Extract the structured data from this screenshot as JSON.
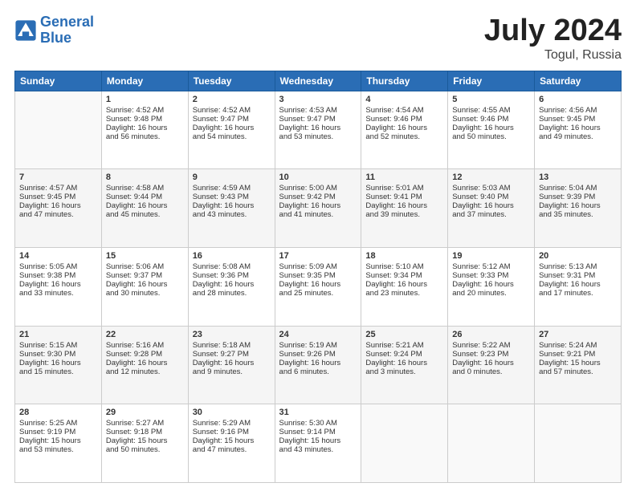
{
  "header": {
    "logo_line1": "General",
    "logo_line2": "Blue",
    "month": "July 2024",
    "location": "Togul, Russia"
  },
  "columns": [
    "Sunday",
    "Monday",
    "Tuesday",
    "Wednesday",
    "Thursday",
    "Friday",
    "Saturday"
  ],
  "weeks": [
    [
      {
        "day": "",
        "content": ""
      },
      {
        "day": "1",
        "content": "Sunrise: 4:52 AM\nSunset: 9:48 PM\nDaylight: 16 hours\nand 56 minutes."
      },
      {
        "day": "2",
        "content": "Sunrise: 4:52 AM\nSunset: 9:47 PM\nDaylight: 16 hours\nand 54 minutes."
      },
      {
        "day": "3",
        "content": "Sunrise: 4:53 AM\nSunset: 9:47 PM\nDaylight: 16 hours\nand 53 minutes."
      },
      {
        "day": "4",
        "content": "Sunrise: 4:54 AM\nSunset: 9:46 PM\nDaylight: 16 hours\nand 52 minutes."
      },
      {
        "day": "5",
        "content": "Sunrise: 4:55 AM\nSunset: 9:46 PM\nDaylight: 16 hours\nand 50 minutes."
      },
      {
        "day": "6",
        "content": "Sunrise: 4:56 AM\nSunset: 9:45 PM\nDaylight: 16 hours\nand 49 minutes."
      }
    ],
    [
      {
        "day": "7",
        "content": "Sunrise: 4:57 AM\nSunset: 9:45 PM\nDaylight: 16 hours\nand 47 minutes."
      },
      {
        "day": "8",
        "content": "Sunrise: 4:58 AM\nSunset: 9:44 PM\nDaylight: 16 hours\nand 45 minutes."
      },
      {
        "day": "9",
        "content": "Sunrise: 4:59 AM\nSunset: 9:43 PM\nDaylight: 16 hours\nand 43 minutes."
      },
      {
        "day": "10",
        "content": "Sunrise: 5:00 AM\nSunset: 9:42 PM\nDaylight: 16 hours\nand 41 minutes."
      },
      {
        "day": "11",
        "content": "Sunrise: 5:01 AM\nSunset: 9:41 PM\nDaylight: 16 hours\nand 39 minutes."
      },
      {
        "day": "12",
        "content": "Sunrise: 5:03 AM\nSunset: 9:40 PM\nDaylight: 16 hours\nand 37 minutes."
      },
      {
        "day": "13",
        "content": "Sunrise: 5:04 AM\nSunset: 9:39 PM\nDaylight: 16 hours\nand 35 minutes."
      }
    ],
    [
      {
        "day": "14",
        "content": "Sunrise: 5:05 AM\nSunset: 9:38 PM\nDaylight: 16 hours\nand 33 minutes."
      },
      {
        "day": "15",
        "content": "Sunrise: 5:06 AM\nSunset: 9:37 PM\nDaylight: 16 hours\nand 30 minutes."
      },
      {
        "day": "16",
        "content": "Sunrise: 5:08 AM\nSunset: 9:36 PM\nDaylight: 16 hours\nand 28 minutes."
      },
      {
        "day": "17",
        "content": "Sunrise: 5:09 AM\nSunset: 9:35 PM\nDaylight: 16 hours\nand 25 minutes."
      },
      {
        "day": "18",
        "content": "Sunrise: 5:10 AM\nSunset: 9:34 PM\nDaylight: 16 hours\nand 23 minutes."
      },
      {
        "day": "19",
        "content": "Sunrise: 5:12 AM\nSunset: 9:33 PM\nDaylight: 16 hours\nand 20 minutes."
      },
      {
        "day": "20",
        "content": "Sunrise: 5:13 AM\nSunset: 9:31 PM\nDaylight: 16 hours\nand 17 minutes."
      }
    ],
    [
      {
        "day": "21",
        "content": "Sunrise: 5:15 AM\nSunset: 9:30 PM\nDaylight: 16 hours\nand 15 minutes."
      },
      {
        "day": "22",
        "content": "Sunrise: 5:16 AM\nSunset: 9:28 PM\nDaylight: 16 hours\nand 12 minutes."
      },
      {
        "day": "23",
        "content": "Sunrise: 5:18 AM\nSunset: 9:27 PM\nDaylight: 16 hours\nand 9 minutes."
      },
      {
        "day": "24",
        "content": "Sunrise: 5:19 AM\nSunset: 9:26 PM\nDaylight: 16 hours\nand 6 minutes."
      },
      {
        "day": "25",
        "content": "Sunrise: 5:21 AM\nSunset: 9:24 PM\nDaylight: 16 hours\nand 3 minutes."
      },
      {
        "day": "26",
        "content": "Sunrise: 5:22 AM\nSunset: 9:23 PM\nDaylight: 16 hours\nand 0 minutes."
      },
      {
        "day": "27",
        "content": "Sunrise: 5:24 AM\nSunset: 9:21 PM\nDaylight: 15 hours\nand 57 minutes."
      }
    ],
    [
      {
        "day": "28",
        "content": "Sunrise: 5:25 AM\nSunset: 9:19 PM\nDaylight: 15 hours\nand 53 minutes."
      },
      {
        "day": "29",
        "content": "Sunrise: 5:27 AM\nSunset: 9:18 PM\nDaylight: 15 hours\nand 50 minutes."
      },
      {
        "day": "30",
        "content": "Sunrise: 5:29 AM\nSunset: 9:16 PM\nDaylight: 15 hours\nand 47 minutes."
      },
      {
        "day": "31",
        "content": "Sunrise: 5:30 AM\nSunset: 9:14 PM\nDaylight: 15 hours\nand 43 minutes."
      },
      {
        "day": "",
        "content": ""
      },
      {
        "day": "",
        "content": ""
      },
      {
        "day": "",
        "content": ""
      }
    ]
  ]
}
